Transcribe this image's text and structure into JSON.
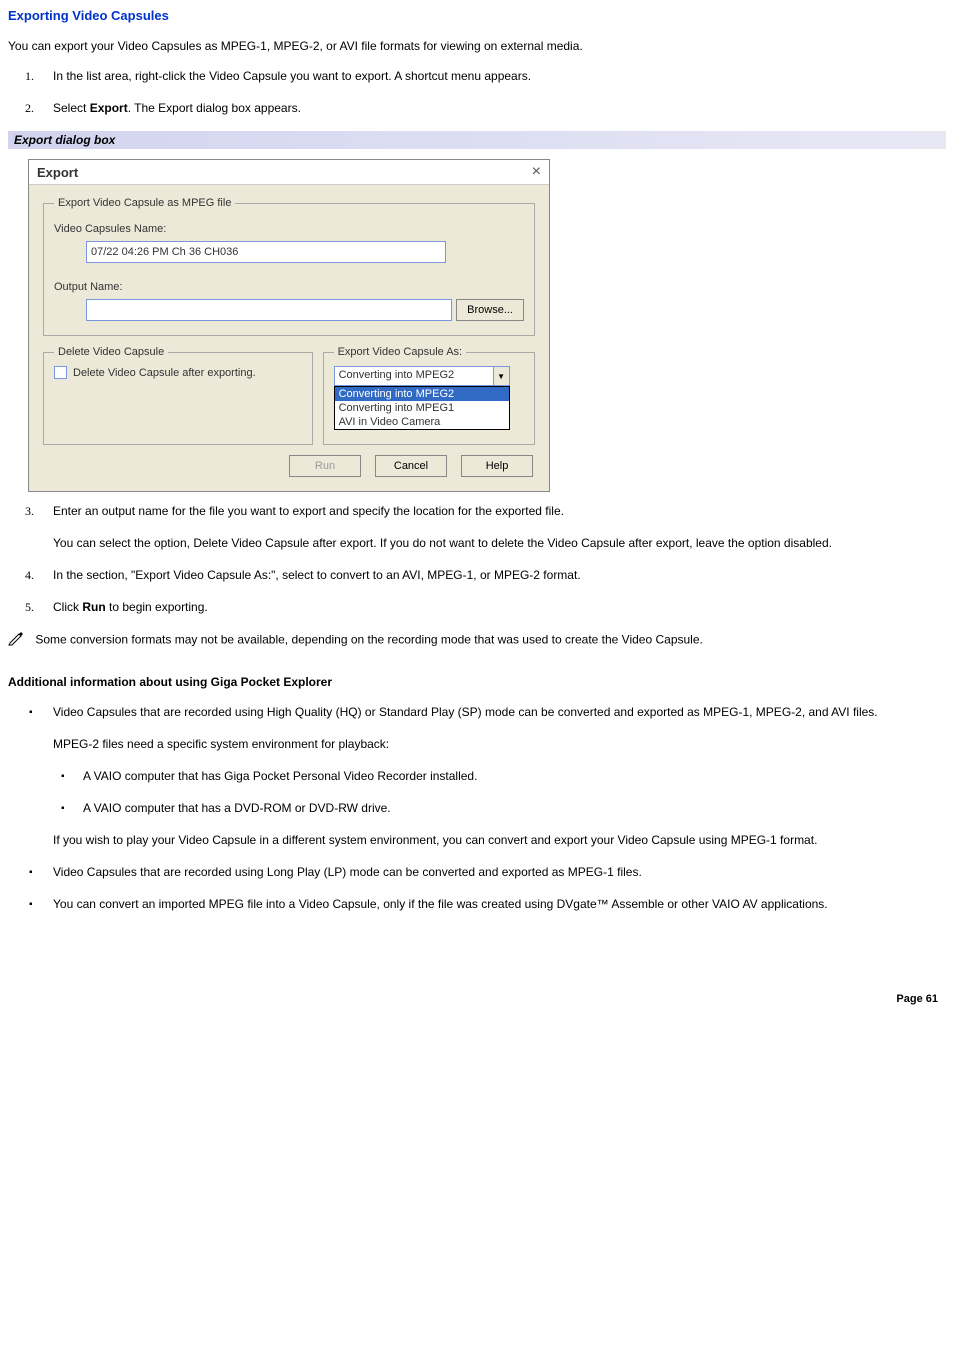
{
  "title": "Exporting Video Capsules",
  "intro": "You can export your Video Capsules as MPEG-1, MPEG-2, or AVI file formats for viewing on external media.",
  "steps_a": [
    {
      "num": "1.",
      "text_pre": "In the list area, right-click the Video Capsule you want to export. A shortcut menu appears."
    },
    {
      "num": "2.",
      "text_pre": "Select ",
      "bold": "Export",
      "text_post": ". The Export dialog box appears."
    }
  ],
  "banner": "Export dialog box",
  "dialog": {
    "title": "Export",
    "close": "×",
    "group1_legend": "Export Video Capsule as MPEG file",
    "vc_name_label": "Video Capsules Name:",
    "vc_name_value": "07/22 04:26 PM Ch 36 CH036",
    "output_label": "Output Name:",
    "output_value": "",
    "browse": "Browse...",
    "delete_legend": "Delete Video Capsule",
    "delete_check_label": "Delete Video Capsule after exporting.",
    "export_as_legend": "Export Video Capsule As:",
    "combo_selected": "Converting into MPEG2",
    "combo_options": [
      "Converting into MPEG2",
      "Converting into MPEG1",
      "AVI in Video Camera"
    ],
    "btn_run": "Run",
    "btn_cancel": "Cancel",
    "btn_help": "Help"
  },
  "steps_b": [
    {
      "num": "3.",
      "text": "Enter an output name for the file you want to export and specify the location for the exported file.",
      "sub": "You can select the option, Delete Video Capsule after export. If you do not want to delete the Video Capsule after export, leave the option disabled."
    },
    {
      "num": "4.",
      "text": "In the section, \"Export Video Capsule As:\", select to convert to an AVI, MPEG-1, or MPEG-2 format."
    },
    {
      "num": "5.",
      "text_pre": "Click ",
      "bold": "Run",
      "text_post": " to begin exporting."
    }
  ],
  "note": " Some conversion formats may not be available, depending on the recording mode that was used to create the Video Capsule.",
  "additional_heading": "Additional information about using Giga Pocket Explorer",
  "bullets": [
    {
      "text": "Video Capsules that are recorded using High Quality (HQ) or Standard Play (SP) mode can be converted and exported as MPEG-1, MPEG-2, and AVI files.",
      "sub": "MPEG-2 files need a specific system environment for playback:",
      "nested": [
        "A VAIO computer that has Giga Pocket Personal Video Recorder installed.",
        "A VAIO computer that has a DVD-ROM or DVD-RW drive."
      ],
      "sub2": "If you wish to play your Video Capsule in a different system environment, you can convert and export your Video Capsule using MPEG-1 format."
    },
    {
      "text": "Video Capsules that are recorded using Long Play (LP) mode can be converted and exported as MPEG-1 files."
    },
    {
      "text": "You can convert an imported MPEG file into a Video Capsule, only if the file was created using DVgate™ Assemble or other VAIO AV applications."
    }
  ],
  "page_footer": "Page 61"
}
